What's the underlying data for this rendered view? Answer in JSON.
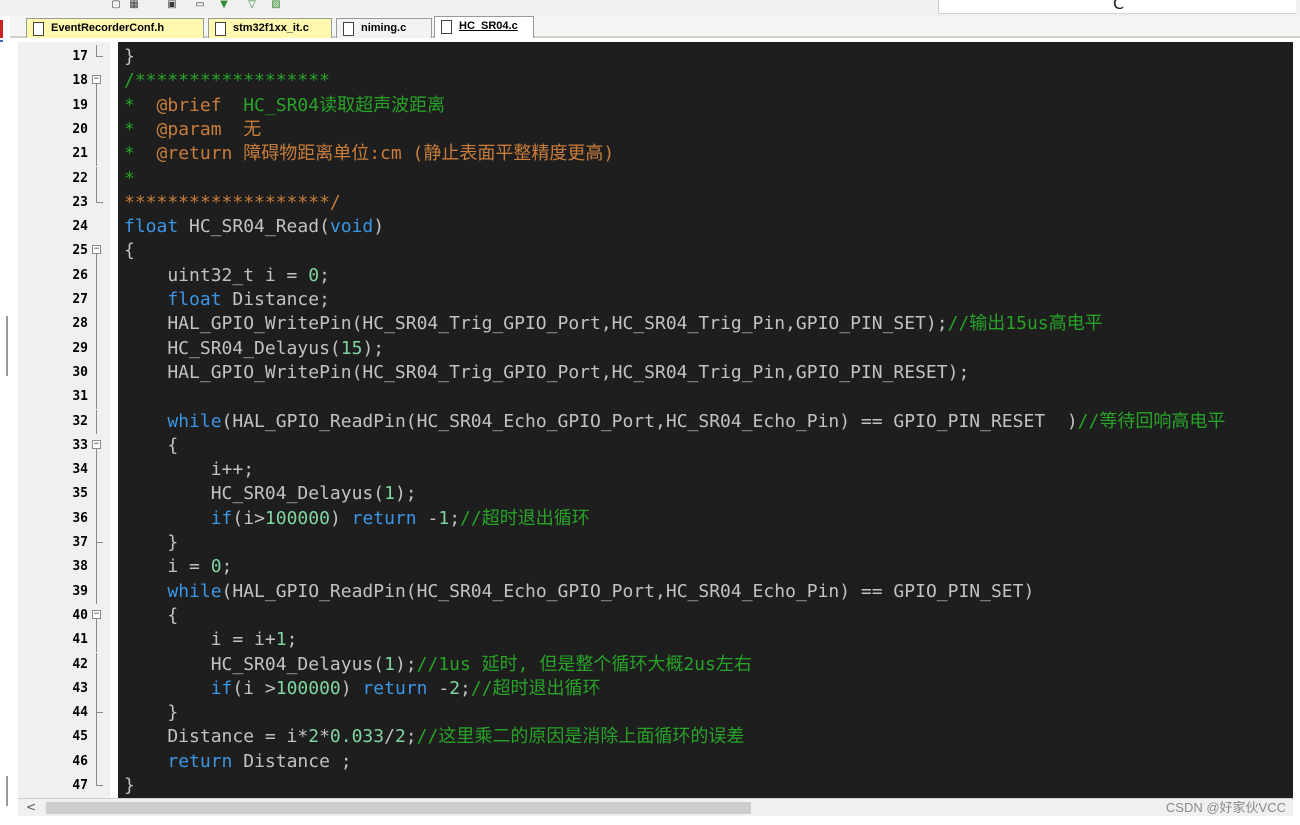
{
  "toolbar": {
    "icons": [
      "tool-icon-1",
      "tool-icon-2",
      "tool-icon-3",
      "tool-icon-4",
      "tool-icon-5",
      "tool-icon-6",
      "tool-icon-7"
    ]
  },
  "floating_panel": {
    "text": "C"
  },
  "tabs": [
    {
      "label": "EventRecorderConf.h",
      "color": "#fff9b0",
      "active": false
    },
    {
      "label": "stm32f1xx_it.c",
      "color": "#fff9b0",
      "active": false
    },
    {
      "label": "niming.c",
      "color": "#f2f2f2",
      "active": false
    },
    {
      "label": "HC_SR04.c",
      "color": "#ffffff",
      "active": true
    }
  ],
  "code": [
    {
      "n": "17",
      "fold": "end",
      "tokens": [
        {
          "t": "}",
          "c": "hd"
        }
      ]
    },
    {
      "n": "18",
      "fold": "start",
      "tokens": [
        {
          "t": "/******************",
          "c": "cm"
        }
      ]
    },
    {
      "n": "19",
      "fold": "line",
      "tokens": [
        {
          "t": "*  ",
          "c": "cm"
        },
        {
          "t": "@brief",
          "c": "cmt"
        },
        {
          "t": "  HC_SR04读取超声波距离",
          "c": "cm"
        }
      ]
    },
    {
      "n": "20",
      "fold": "line",
      "tokens": [
        {
          "t": "*  ",
          "c": "cm"
        },
        {
          "t": "@param",
          "c": "cmt"
        },
        {
          "t": "  无",
          "c": "cmt"
        }
      ]
    },
    {
      "n": "21",
      "fold": "line",
      "tokens": [
        {
          "t": "*  ",
          "c": "cm"
        },
        {
          "t": "@return",
          "c": "cmt"
        },
        {
          "t": " 障碍物距离单位:cm (静止表面平整精度更高)",
          "c": "cmt"
        }
      ]
    },
    {
      "n": "22",
      "fold": "line",
      "tokens": [
        {
          "t": "*",
          "c": "cm"
        }
      ]
    },
    {
      "n": "23",
      "fold": "end",
      "tokens": [
        {
          "t": "*******************/",
          "c": "cmt"
        }
      ]
    },
    {
      "n": "24",
      "fold": "none",
      "tokens": [
        {
          "t": "float",
          "c": "kw"
        },
        {
          "t": " HC_SR04_Read(",
          "c": "hd"
        },
        {
          "t": "void",
          "c": "kw"
        },
        {
          "t": ")",
          "c": "hd"
        }
      ]
    },
    {
      "n": "25",
      "fold": "start",
      "tokens": [
        {
          "t": "{",
          "c": "hd"
        }
      ]
    },
    {
      "n": "26",
      "fold": "line",
      "tokens": [
        {
          "t": "    uint32_t i = ",
          "c": "hd"
        },
        {
          "t": "0",
          "c": "num"
        },
        {
          "t": ";",
          "c": "hd"
        }
      ]
    },
    {
      "n": "27",
      "fold": "line",
      "tokens": [
        {
          "t": "    ",
          "c": "hd"
        },
        {
          "t": "float",
          "c": "kw"
        },
        {
          "t": " Distance;",
          "c": "hd"
        }
      ]
    },
    {
      "n": "28",
      "fold": "line",
      "tokens": [
        {
          "t": "    HAL_GPIO_WritePin(HC_SR04_Trig_GPIO_Port,HC_SR04_Trig_Pin,GPIO_PIN_SET);",
          "c": "hd"
        },
        {
          "t": "//输出15us高电平",
          "c": "cm"
        }
      ]
    },
    {
      "n": "29",
      "fold": "line",
      "tokens": [
        {
          "t": "    HC_SR04_Delayus(",
          "c": "hd"
        },
        {
          "t": "15",
          "c": "num"
        },
        {
          "t": ");",
          "c": "hd"
        }
      ]
    },
    {
      "n": "30",
      "fold": "line",
      "tokens": [
        {
          "t": "    HAL_GPIO_WritePin(HC_SR04_Trig_GPIO_Port,HC_SR04_Trig_Pin,GPIO_PIN_RESET);",
          "c": "hd"
        }
      ]
    },
    {
      "n": "31",
      "fold": "line",
      "tokens": []
    },
    {
      "n": "32",
      "fold": "line",
      "tokens": [
        {
          "t": "    ",
          "c": "hd"
        },
        {
          "t": "while",
          "c": "kw"
        },
        {
          "t": "(HAL_GPIO_ReadPin(HC_SR04_Echo_GPIO_Port,HC_SR04_Echo_Pin) == GPIO_PIN_RESET  )",
          "c": "hd"
        },
        {
          "t": "//等待回响高电平",
          "c": "cm"
        }
      ]
    },
    {
      "n": "33",
      "fold": "start",
      "tokens": [
        {
          "t": "    {",
          "c": "hd"
        }
      ]
    },
    {
      "n": "34",
      "fold": "line",
      "tokens": [
        {
          "t": "        i++;",
          "c": "hd"
        }
      ]
    },
    {
      "n": "35",
      "fold": "line",
      "tokens": [
        {
          "t": "        HC_SR04_Delayus(",
          "c": "hd"
        },
        {
          "t": "1",
          "c": "num"
        },
        {
          "t": ");",
          "c": "hd"
        }
      ]
    },
    {
      "n": "36",
      "fold": "line",
      "tokens": [
        {
          "t": "        ",
          "c": "hd"
        },
        {
          "t": "if",
          "c": "kw"
        },
        {
          "t": "(i>",
          "c": "hd"
        },
        {
          "t": "100000",
          "c": "num"
        },
        {
          "t": ") ",
          "c": "hd"
        },
        {
          "t": "return",
          "c": "kw"
        },
        {
          "t": " -",
          "c": "hd"
        },
        {
          "t": "1",
          "c": "num"
        },
        {
          "t": ";",
          "c": "hd"
        },
        {
          "t": "//超时退出循环",
          "c": "cm"
        }
      ]
    },
    {
      "n": "37",
      "fold": "endmid",
      "tokens": [
        {
          "t": "    }",
          "c": "hd"
        }
      ]
    },
    {
      "n": "38",
      "fold": "line",
      "tokens": [
        {
          "t": "    i = ",
          "c": "hd"
        },
        {
          "t": "0",
          "c": "num"
        },
        {
          "t": ";",
          "c": "hd"
        }
      ]
    },
    {
      "n": "39",
      "fold": "line",
      "tokens": [
        {
          "t": "    ",
          "c": "hd"
        },
        {
          "t": "while",
          "c": "kw"
        },
        {
          "t": "(HAL_GPIO_ReadPin(HC_SR04_Echo_GPIO_Port,HC_SR04_Echo_Pin) == GPIO_PIN_SET)",
          "c": "hd"
        }
      ]
    },
    {
      "n": "40",
      "fold": "start",
      "tokens": [
        {
          "t": "    {",
          "c": "hd"
        }
      ]
    },
    {
      "n": "41",
      "fold": "line",
      "tokens": [
        {
          "t": "        i = i+",
          "c": "hd"
        },
        {
          "t": "1",
          "c": "num"
        },
        {
          "t": ";",
          "c": "hd"
        }
      ]
    },
    {
      "n": "42",
      "fold": "line",
      "tokens": [
        {
          "t": "        HC_SR04_Delayus(",
          "c": "hd"
        },
        {
          "t": "1",
          "c": "num"
        },
        {
          "t": ");",
          "c": "hd"
        },
        {
          "t": "//1us 延时, 但是整个循环大概2us左右",
          "c": "cm"
        }
      ]
    },
    {
      "n": "43",
      "fold": "line",
      "tokens": [
        {
          "t": "        ",
          "c": "hd"
        },
        {
          "t": "if",
          "c": "kw"
        },
        {
          "t": "(i >",
          "c": "hd"
        },
        {
          "t": "100000",
          "c": "num"
        },
        {
          "t": ") ",
          "c": "hd"
        },
        {
          "t": "return",
          "c": "kw"
        },
        {
          "t": " -",
          "c": "hd"
        },
        {
          "t": "2",
          "c": "num"
        },
        {
          "t": ";",
          "c": "hd"
        },
        {
          "t": "//超时退出循环",
          "c": "cm"
        }
      ]
    },
    {
      "n": "44",
      "fold": "endmid",
      "tokens": [
        {
          "t": "    }",
          "c": "hd"
        }
      ]
    },
    {
      "n": "45",
      "fold": "line",
      "tokens": [
        {
          "t": "    Distance = i*",
          "c": "hd"
        },
        {
          "t": "2",
          "c": "num"
        },
        {
          "t": "*",
          "c": "hd"
        },
        {
          "t": "0.033",
          "c": "num"
        },
        {
          "t": "/",
          "c": "hd"
        },
        {
          "t": "2",
          "c": "num"
        },
        {
          "t": ";",
          "c": "hd"
        },
        {
          "t": "//这里乘二的原因是消除上面循环的误差",
          "c": "cm"
        }
      ]
    },
    {
      "n": "46",
      "fold": "line",
      "tokens": [
        {
          "t": "    ",
          "c": "hd"
        },
        {
          "t": "return",
          "c": "kw"
        },
        {
          "t": " Distance ;",
          "c": "hd"
        }
      ]
    },
    {
      "n": "47",
      "fold": "end",
      "tokens": [
        {
          "t": "}",
          "c": "hd"
        }
      ]
    }
  ],
  "scrollbar": {
    "left_arrow": "<"
  },
  "watermark": "CSDN @好家伙VCC"
}
